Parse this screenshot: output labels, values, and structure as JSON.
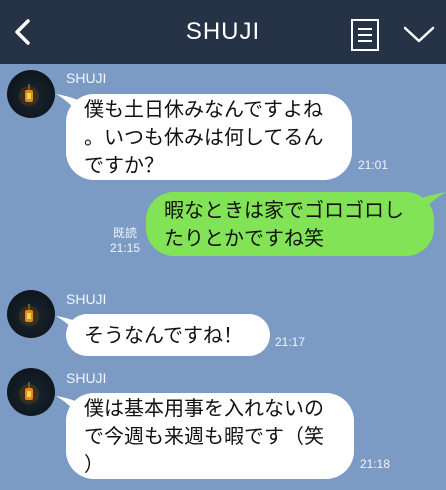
{
  "header": {
    "title": "SHUJI",
    "back_icon": "chevron-left-icon",
    "note_icon": "note-icon",
    "menu_icon": "chevron-down-icon"
  },
  "colors": {
    "header_bg": "#263246",
    "chat_bg": "#7c9bc4",
    "incoming_bubble": "#ffffff",
    "outgoing_bubble": "#83e357"
  },
  "messages": [
    {
      "direction": "incoming",
      "sender": "SHUJI",
      "lines": [
        "僕も土日休みなんですよね",
        "。いつも休みは何してるん",
        "ですか？"
      ],
      "time": "21:01"
    },
    {
      "direction": "outgoing",
      "lines": [
        "暇なときは家でゴロゴロし",
        "たりとかですね笑"
      ],
      "read": "既読",
      "time": "21:15"
    },
    {
      "direction": "incoming",
      "sender": "SHUJI",
      "lines": [
        "そうなんですね！"
      ],
      "time": "21:17"
    },
    {
      "direction": "incoming",
      "sender": "SHUJI",
      "lines": [
        "僕は基本用事を入れないの",
        "で今週も来週も暇です（笑",
        "）"
      ],
      "time": "21:18"
    }
  ]
}
